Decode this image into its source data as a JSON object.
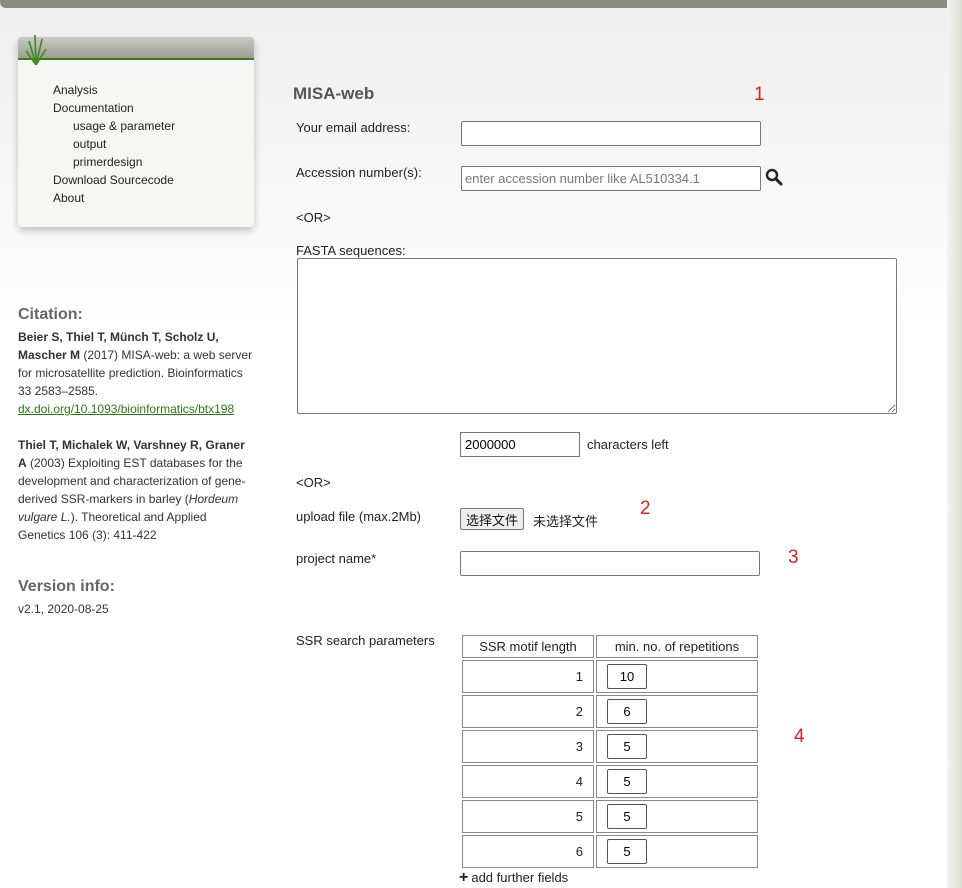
{
  "nav": {
    "items": [
      "Analysis",
      "Documentation",
      "usage & parameter",
      "output",
      "primerdesign",
      "Download Sourcecode",
      "About"
    ]
  },
  "citation": {
    "heading": "Citation:",
    "ref1_authors": "Beier S, Thiel T, Münch T, Scholz U, Mascher M",
    "ref1_text": " (2017) MISA-web: a web server for microsatellite prediction. Bioinformatics 33 2583–2585.",
    "ref1_link": "dx.doi.org/10.1093/bioinformatics/btx198",
    "ref2_authors": "Thiel T, Michalek W, Varshney R, Graner A",
    "ref2_text_a": " (2003) Exploiting EST databases for the development and characterization of gene-derived SSR-markers in barley (",
    "ref2_species": "Hordeum vulgare L.",
    "ref2_text_b": "). Theoretical and Applied Genetics 106 (3): 411-422"
  },
  "version": {
    "heading": "Version info:",
    "value": "v2.1, 2020-08-25"
  },
  "form": {
    "title": "MISA-web",
    "email_label": "Your email address:",
    "email_value": "",
    "accession_label": "Accession number(s):",
    "accession_placeholder": "enter accession number like AL510334.1",
    "or_label": "<OR>",
    "fasta_label": "FASTA sequences:",
    "chars_value": "2000000",
    "chars_label": "characters left",
    "upload_label": "upload file (max.2Mb)",
    "file_button": "选择文件",
    "file_status": "未选择文件",
    "project_label": "project name*",
    "project_value": "",
    "ssr_label": "SSR search parameters",
    "ssr_col1": "SSR motif length",
    "ssr_col2": "min. no. of repetitions",
    "ssr_rows": [
      {
        "length": "1",
        "reps": "10"
      },
      {
        "length": "2",
        "reps": "6"
      },
      {
        "length": "3",
        "reps": "5"
      },
      {
        "length": "4",
        "reps": "5"
      },
      {
        "length": "5",
        "reps": "5"
      },
      {
        "length": "6",
        "reps": "5"
      }
    ],
    "add_fields": "add further fields"
  },
  "annotations": [
    "1",
    "2",
    "3",
    "4"
  ],
  "colors": {
    "link": "#2a7a12",
    "annotation": "#e02020",
    "menu_bar": "#3b7a1e"
  },
  "icons": [
    "search-icon",
    "plus-icon",
    "grass-logo-icon"
  ]
}
